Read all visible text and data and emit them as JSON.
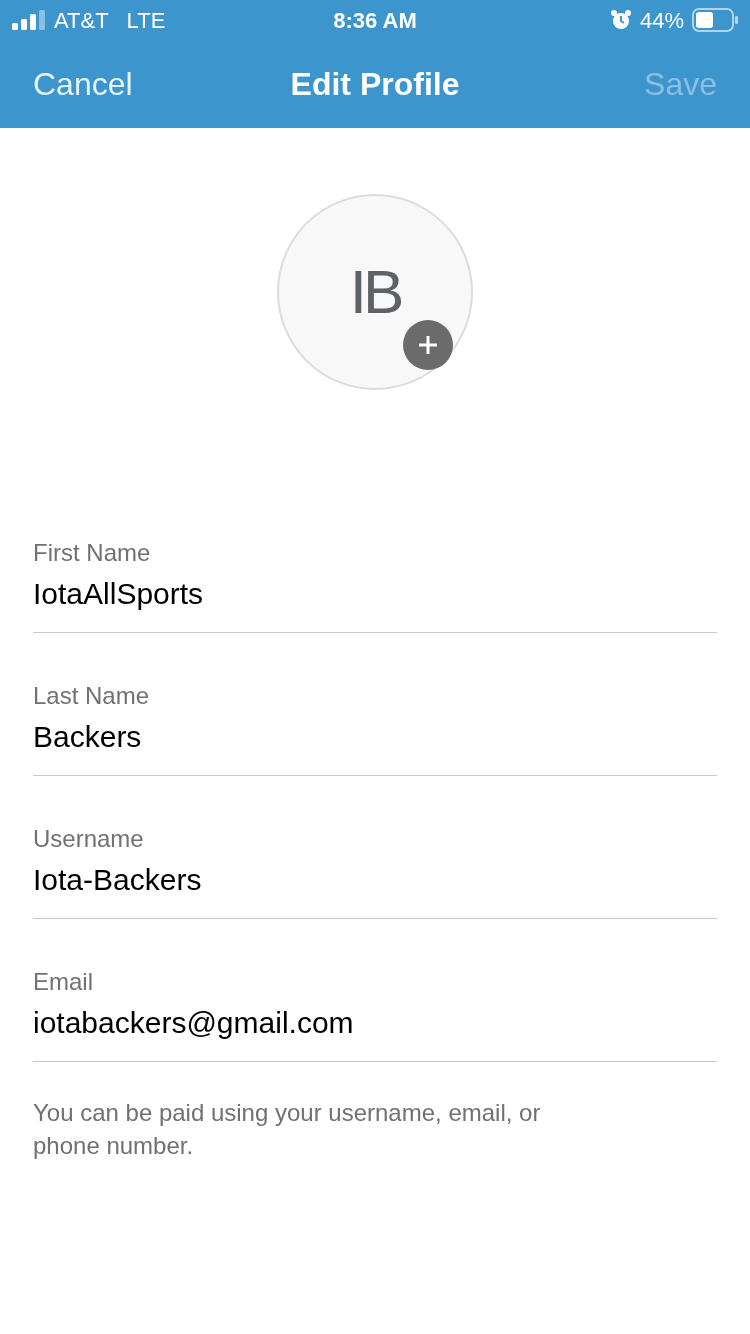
{
  "status_bar": {
    "carrier": "AT&T",
    "network": "LTE",
    "time": "8:36 AM",
    "battery": "44%"
  },
  "nav": {
    "cancel": "Cancel",
    "title": "Edit Profile",
    "save": {
      "label": "Save",
      "disabled": true
    }
  },
  "avatar": {
    "initials": "IB"
  },
  "fields": [
    {
      "label": "First Name",
      "value": "IotaAllSports"
    },
    {
      "label": "Last Name",
      "value": "Backers"
    },
    {
      "label": "Username",
      "value": "Iota-Backers"
    },
    {
      "label": "Email",
      "value": "iotabackers@gmail.com"
    }
  ],
  "note": "You can be paid using your username, email, or phone number."
}
